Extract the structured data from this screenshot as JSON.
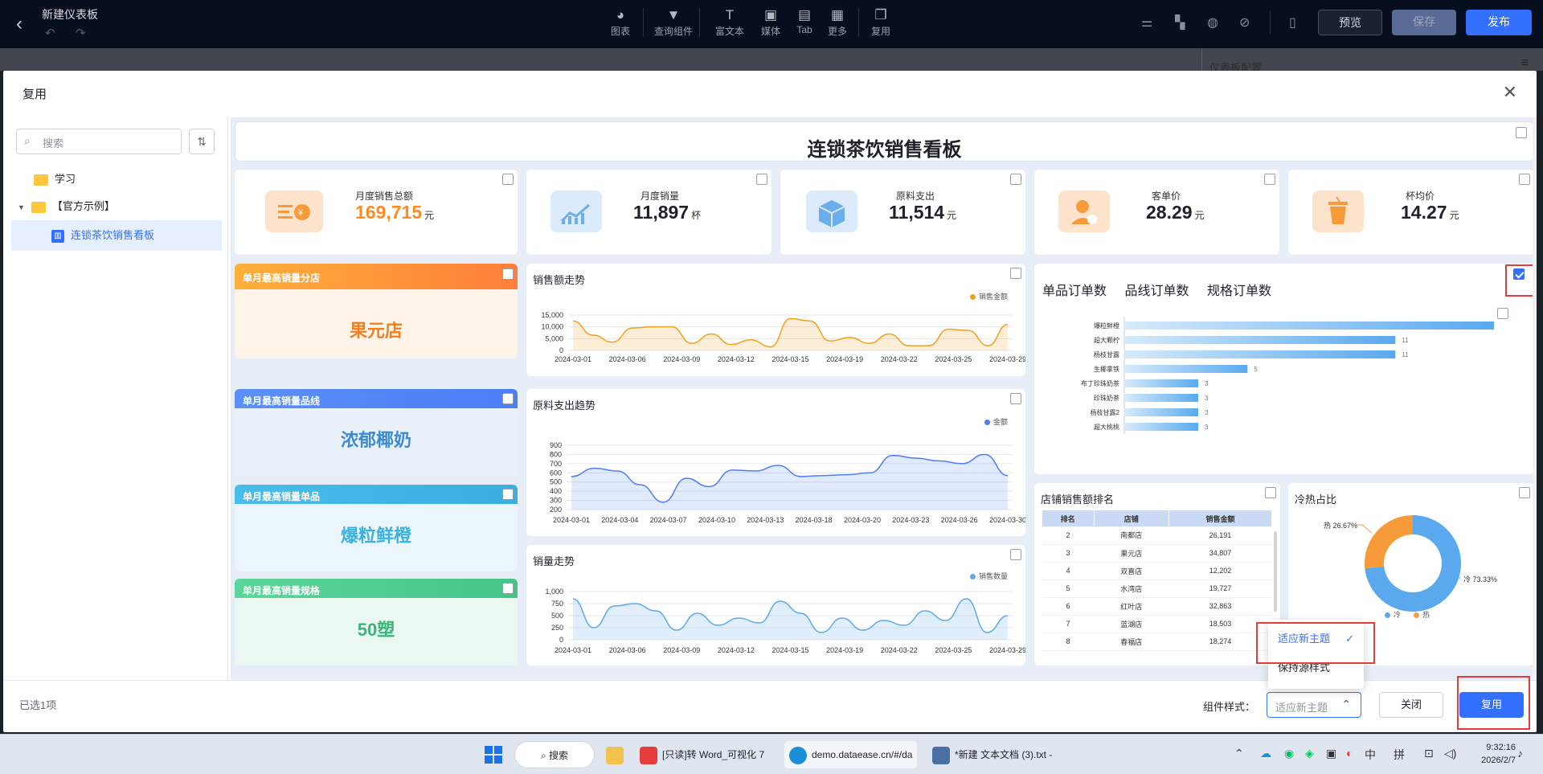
{
  "topbar": {
    "back_icon": "chevron-left",
    "title": "新建仪表板",
    "tools": [
      {
        "label": "图表",
        "icon": "chart-pie"
      },
      {
        "label": "查询组件",
        "icon": "filter"
      },
      {
        "label": "富文本",
        "icon": "text-t"
      },
      {
        "label": "媒体",
        "icon": "image"
      },
      {
        "label": "Tab",
        "icon": "tab"
      },
      {
        "label": "更多",
        "icon": "grid"
      },
      {
        "label": "复用",
        "icon": "copy"
      }
    ],
    "preview": "预览",
    "save": "保存",
    "publish": "发布"
  },
  "underlay": {
    "config_title": "仪表板配置"
  },
  "modal": {
    "title": "复用",
    "search_placeholder": "搜索",
    "tree": [
      {
        "label": "学习",
        "type": "folder"
      },
      {
        "label": "【官方示例】",
        "type": "folder"
      },
      {
        "label": "连锁茶饮销售看板",
        "type": "dashboard",
        "selected": true
      }
    ],
    "selected_count": "已选1项",
    "style_label": "组件样式：",
    "style_value": "适应新主题",
    "style_options": [
      {
        "label": "适应新主题",
        "selected": true
      },
      {
        "label": "保持源样式",
        "selected": false
      }
    ],
    "close": "关闭",
    "reuse": "复用"
  },
  "dashboard": {
    "title": "连锁茶饮销售看板",
    "kpis": [
      {
        "label": "月度销售总额",
        "value": "169,715",
        "unit": "元",
        "color": "#ff8a1f",
        "icon_bg": "#fde3cc"
      },
      {
        "label": "月度销量",
        "value": "11,897",
        "unit": "杯",
        "color": "#1f2329",
        "icon_bg": "#dcebfb"
      },
      {
        "label": "原料支出",
        "value": "11,514",
        "unit": "元",
        "color": "#1f2329",
        "icon_bg": "#dcebfb"
      },
      {
        "label": "客单价",
        "value": "28.29",
        "unit": "元",
        "color": "#1f2329",
        "icon_bg": "#fde3cc"
      },
      {
        "label": "杯均价",
        "value": "14.27",
        "unit": "元",
        "color": "#1f2329",
        "icon_bg": "#fde3cc"
      }
    ],
    "tops": [
      {
        "head": "单月最高销量分店",
        "value": "果元店",
        "head_color": "#ff8a3d",
        "value_color": "#f07f1e",
        "bg": "#fff4ea"
      },
      {
        "head": "单月最高销量品线",
        "value": "浓郁椰奶",
        "head_color": "#4d8ff7",
        "value_color": "#3a8ad6",
        "bg": "#eaf1fb"
      },
      {
        "head": "单月最高销量单品",
        "value": "爆粒鲜橙",
        "head_color": "#3fb6e6",
        "value_color": "#3ab2e0",
        "bg": "#eaf6fb"
      },
      {
        "head": "单月最高销量规格",
        "value": "50塑",
        "head_color": "#48c98a",
        "value_color": "#3bb577",
        "bg": "#eaf8f1"
      }
    ],
    "sales_trend": {
      "title": "销售额走势",
      "legend": "销售金额"
    },
    "cost_trend": {
      "title": "原料支出趋势",
      "legend": "金额"
    },
    "volume_trend": {
      "title": "销量走势",
      "legend": "销售数量"
    },
    "orders": {
      "tabs": [
        "单品订单数",
        "品线订单数",
        "规格订单数"
      ]
    },
    "rank": {
      "title": "店铺销售额排名",
      "headers": [
        "排名",
        "店铺",
        "销售金额"
      ]
    },
    "pie": {
      "title": "冷热占比",
      "hot_label": "热 26.67%",
      "cold_label": "冷 73.33%",
      "legend": [
        "冷",
        "热"
      ]
    }
  },
  "chart_data": [
    {
      "type": "area",
      "title": "销售额走势",
      "x_ticks": [
        "2024-03-01",
        "2024-03-06",
        "2024-03-09",
        "2024-03-12",
        "2024-03-15",
        "2024-03-19",
        "2024-03-22",
        "2024-03-25",
        "2024-03-29"
      ],
      "y_ticks": [
        "15,000",
        "10,000",
        "5,000",
        "0"
      ],
      "ylim": [
        0,
        15000
      ],
      "series": [
        {
          "name": "销售金额",
          "values": [
            12500,
            6500,
            3500,
            9500,
            10000,
            10000,
            3000,
            7000,
            2500,
            4500,
            1500,
            13500,
            12500,
            4000,
            5500,
            3000,
            7000,
            2000,
            2000,
            9000,
            8500,
            2000,
            11000
          ]
        }
      ]
    },
    {
      "type": "area",
      "title": "原料支出趋势",
      "x_ticks": [
        "2024-03-01",
        "2024-03-04",
        "2024-03-07",
        "2024-03-10",
        "2024-03-13",
        "2024-03-18",
        "2024-03-20",
        "2024-03-23",
        "2024-03-26",
        "2024-03-30"
      ],
      "y_ticks": [
        "900",
        "800",
        "700",
        "600",
        "500",
        "400",
        "300",
        "200"
      ],
      "ylim": [
        200,
        900
      ],
      "series": [
        {
          "name": "金额",
          "values": [
            560,
            650,
            620,
            470,
            280,
            540,
            450,
            630,
            620,
            680,
            560,
            570,
            580,
            600,
            790,
            760,
            730,
            700,
            800,
            570
          ]
        }
      ]
    },
    {
      "type": "area",
      "title": "销量走势",
      "x_ticks": [
        "2024-03-01",
        "2024-03-06",
        "2024-03-09",
        "2024-03-12",
        "2024-03-15",
        "2024-03-19",
        "2024-03-22",
        "2024-03-25",
        "2024-03-29"
      ],
      "y_ticks": [
        "1,000",
        "750",
        "500",
        "250",
        "0"
      ],
      "ylim": [
        0,
        1000
      ],
      "series": [
        {
          "name": "销售数量",
          "values": [
            850,
            250,
            700,
            750,
            600,
            200,
            550,
            300,
            450,
            350,
            800,
            550,
            150,
            450,
            200,
            400,
            300,
            600,
            400,
            850,
            150,
            500
          ]
        }
      ]
    },
    {
      "type": "bar",
      "title": "单品订单数",
      "categories": [
        "爆粒鲜橙",
        "超大颗柠",
        "杨枝甘露",
        "生椰拿铁",
        "布丁珍珠奶茶",
        "珍珠奶茶",
        "杨枝甘露2",
        "超大桃桃"
      ],
      "series": [
        {
          "name": "订单数",
          "values": [
            15,
            11,
            11,
            5,
            3,
            3,
            3,
            3
          ]
        }
      ],
      "labels": [
        "",
        "11",
        "11",
        "5",
        "3",
        "3",
        "3",
        "3"
      ]
    },
    {
      "type": "table",
      "title": "店铺销售额排名",
      "rows": [
        [
          "2",
          "南都店",
          "26,191"
        ],
        [
          "3",
          "果元店",
          "34,807"
        ],
        [
          "4",
          "双喜店",
          "12,202"
        ],
        [
          "5",
          "水湾店",
          "19,727"
        ],
        [
          "6",
          "红叶店",
          "32,863"
        ],
        [
          "7",
          "蓝湖店",
          "18,503"
        ],
        [
          "8",
          "春福店",
          "18,274"
        ]
      ]
    },
    {
      "type": "pie",
      "title": "冷热占比",
      "series": [
        {
          "name": "冷",
          "value": 73.33,
          "color": "#5aa9ef"
        },
        {
          "name": "热",
          "value": 26.67,
          "color": "#f79a3a"
        }
      ]
    }
  ],
  "taskbar": {
    "search": "搜索",
    "apps": [
      "[只读]转 Word_可视化 7",
      "demo.dataease.cn/#/da",
      "*新建 文本文档 (3).txt - "
    ],
    "ime": [
      "中",
      "拼"
    ],
    "time": "9:32:16",
    "date": "2026/2/7"
  }
}
